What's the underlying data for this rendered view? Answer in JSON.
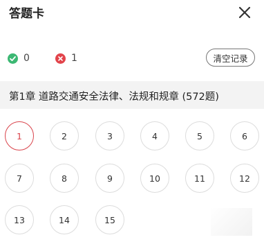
{
  "header": {
    "title": "答题卡",
    "close_icon": "close-icon"
  },
  "stats": {
    "correct_icon": "check-icon",
    "correct_color": "#3cb873",
    "correct_count": "0",
    "wrong_icon": "x-icon",
    "wrong_color": "#e2444b",
    "wrong_count": "1",
    "clear_label": "清空记录"
  },
  "chapter": {
    "title": "第1章  道路交通安全法律、法规和规章 (572题)"
  },
  "questions": {
    "current": "1",
    "accent_color": "#d9434b",
    "labels": [
      "1",
      "2",
      "3",
      "4",
      "5",
      "6",
      "7",
      "8",
      "9",
      "10",
      "11",
      "12",
      "13",
      "14",
      "15"
    ]
  }
}
